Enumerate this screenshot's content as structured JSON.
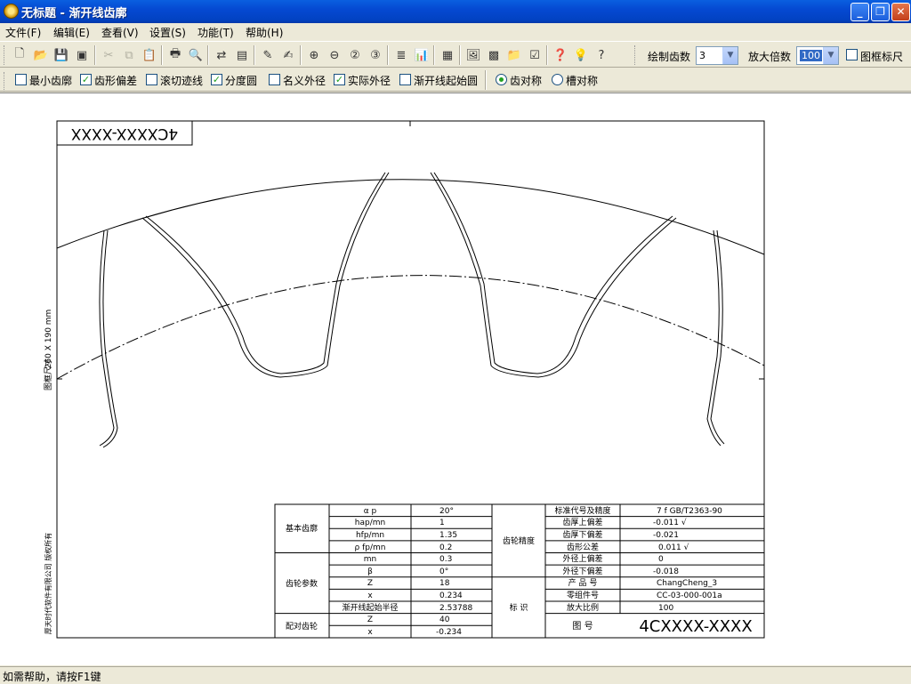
{
  "window": {
    "title": "无标题 - 渐开线齿廓"
  },
  "menu": [
    "文件(F)",
    "编辑(E)",
    "查看(V)",
    "设置(S)",
    "功能(T)",
    "帮助(H)"
  ],
  "toolbar": {
    "tooth_count_label": "绘制齿数",
    "tooth_count_value": "3",
    "zoom_label": "放大倍数",
    "zoom_value": "100",
    "frame_ruler_label": "图框标尺",
    "frame_ruler_checked": false
  },
  "options": [
    {
      "label": "最小齿廓",
      "checked": false
    },
    {
      "label": "齿形偏差",
      "checked": true
    },
    {
      "label": "滚切迹线",
      "checked": false
    },
    {
      "label": "分度圆",
      "checked": true
    },
    {
      "label": "名义外径",
      "checked": false
    },
    {
      "label": "实际外径",
      "checked": true
    },
    {
      "label": "渐开线起始圆",
      "checked": false
    }
  ],
  "symmetry": [
    {
      "label": "齿对称",
      "selected": true
    },
    {
      "label": "槽对称",
      "selected": false
    }
  ],
  "drawing": {
    "corner_drawing_no": "4CXXXX-XXXX",
    "frame_size_label": "图框尺寸",
    "frame_size_value": "260 X 190 mm",
    "company": "厚天时代软件有限公司 版权所有",
    "table": {
      "basic_profile_label": "基本齿廓",
      "gear_params_label": "齿轮参数",
      "mating_gear_label": "配对齿轮",
      "accuracy_label": "齿轮精度",
      "identification_label": "标 识",
      "rows": [
        {
          "name": "α p",
          "value": "20°"
        },
        {
          "name": "hap/mn",
          "value": "1"
        },
        {
          "name": "hfp/mn",
          "value": "1.35"
        },
        {
          "name": "ρ fp/mn",
          "value": "0.2"
        },
        {
          "name": "mn",
          "value": "0.3"
        },
        {
          "name": "β",
          "value": "0°"
        },
        {
          "name": "Z",
          "value": "18"
        },
        {
          "name": "x",
          "value": "0.234"
        },
        {
          "name": "渐开线起始半径",
          "value": "2.53788"
        },
        {
          "name": "Z",
          "value": "40"
        },
        {
          "name": "x",
          "value": "-0.234"
        }
      ],
      "right_rows": [
        {
          "name": "标准代号及精度",
          "value": "7 f GB/T2363-90"
        },
        {
          "name": "齿厚上偏差",
          "value": "-0.011   √"
        },
        {
          "name": "齿厚下偏差",
          "value": "-0.021"
        },
        {
          "name": "齿形公差",
          "value": "0.011   √"
        },
        {
          "name": "外径上偏差",
          "value": "0"
        },
        {
          "name": "外径下偏差",
          "value": "-0.018"
        },
        {
          "name": "产 品 号",
          "value": "ChangCheng_3"
        },
        {
          "name": "零组件号",
          "value": "CC-03-000-001a"
        },
        {
          "name": "放大比例",
          "value": "100"
        },
        {
          "name": "图   号",
          "value": "4CXXXX-XXXX"
        }
      ]
    }
  },
  "status": "如需帮助，请按F1键"
}
